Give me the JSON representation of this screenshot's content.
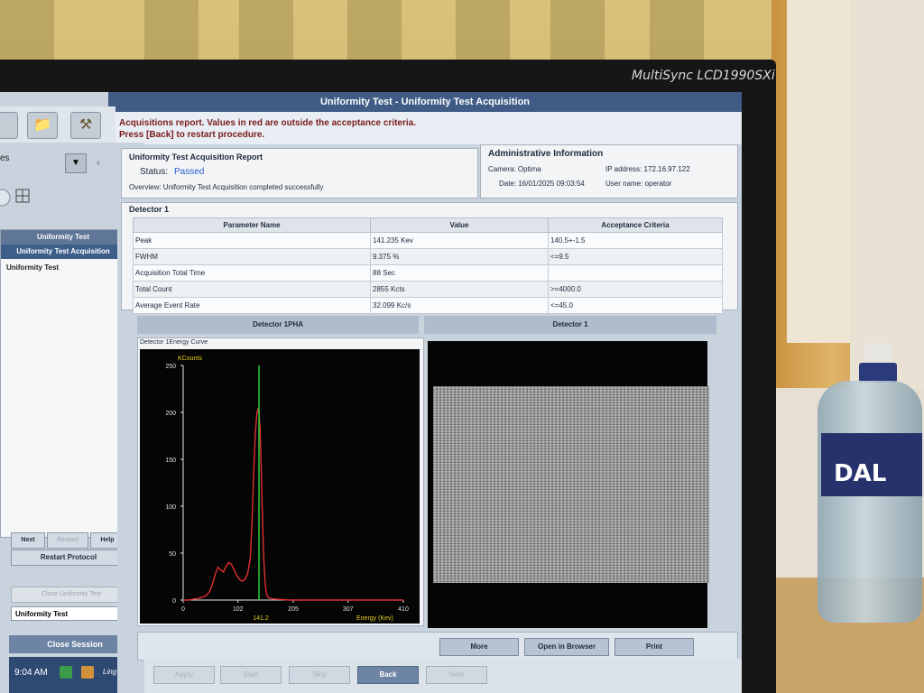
{
  "monitor": {
    "brand": "MultiSync LCD1990SXi"
  },
  "bottle": {
    "label": "DAL"
  },
  "window": {
    "title": "Uniformity Test  - Uniformity Test Acquisition"
  },
  "message": {
    "line1": "Acquisitions report. Values in red are outside the acceptance criteria.",
    "line2": "Press [Back] to restart procedure."
  },
  "sidebar": {
    "dropdown_text": "es",
    "header": "Uniformity Test",
    "selected_item": "Uniformity Test Acquisition",
    "item": "Uniformity Test",
    "buttons": {
      "next": "Next",
      "middle": "Restart",
      "help": "Help"
    },
    "restart_protocol": "Restart Protocol",
    "close_test": "Close Uniformity Test",
    "select_value": "Uniformity Test",
    "close_session": "Close Session"
  },
  "taskbar": {
    "time": "9:04 AM",
    "ling": "Ling"
  },
  "report": {
    "title": "Uniformity Test Acquisition Report",
    "status_label": "Status:",
    "status_value": "Passed",
    "overview": "Overview: Uniformity Test Acquisition completed successfully"
  },
  "admin": {
    "title": "Administrative Information",
    "camera": "Camera: Optima",
    "ip": "IP address: 172.16.97.122",
    "date": "Date: 16/01/2025 09:03:54",
    "user": "User name: operator"
  },
  "detector": {
    "title": "Detector 1",
    "columns": [
      "Parameter Name",
      "Value",
      "Acceptance Criteria"
    ],
    "rows": [
      [
        "Peak",
        "141.235 Kev",
        "140.5+-1.5"
      ],
      [
        "FWHM",
        "9.375 %",
        "<=9.5"
      ],
      [
        "Acquisition Total Time",
        "88 Sec",
        ""
      ],
      [
        "Total Count",
        "2855 Kcts",
        ">=4000.0"
      ],
      [
        "Average Event Rate",
        "32.099 Kc/s",
        "<=45.0"
      ]
    ]
  },
  "pha": {
    "header": "Detector 1PHA",
    "subtitle": "Detector 1Energy Curve"
  },
  "image_panel": {
    "header": "Detector 1"
  },
  "chart_data": {
    "type": "line",
    "title": "Detector 1Energy Curve",
    "ylabel": "KCounts",
    "xlabel": "Energy (Kev)",
    "xlim": [
      0,
      410
    ],
    "ylim": [
      0,
      250
    ],
    "x_ticks": [
      0,
      102,
      205,
      307,
      410
    ],
    "y_ticks": [
      0,
      50,
      100,
      150,
      200,
      250
    ],
    "marker_label": "141.2",
    "marker_color": "#33cc33",
    "series": [
      {
        "color": "#e03030",
        "x": [
          0,
          10,
          20,
          30,
          40,
          45,
          50,
          55,
          60,
          65,
          70,
          75,
          80,
          85,
          90,
          95,
          100,
          105,
          110,
          115,
          120,
          125,
          128,
          131,
          134,
          137,
          139,
          141,
          143,
          145,
          147,
          150,
          153,
          156,
          160,
          170,
          200,
          250,
          300,
          350,
          410
        ],
        "y": [
          0,
          0,
          1,
          2,
          4,
          6,
          10,
          18,
          28,
          35,
          32,
          30,
          36,
          40,
          38,
          32,
          26,
          22,
          20,
          22,
          28,
          45,
          80,
          130,
          175,
          198,
          203,
          200,
          185,
          150,
          100,
          45,
          15,
          5,
          2,
          1,
          0,
          0,
          0,
          0,
          0
        ]
      }
    ],
    "line_annotation": "141.2"
  },
  "bottom_buttons": {
    "more": "More",
    "open_browser": "Open in Browser",
    "print": "Print"
  },
  "nav": {
    "apply": "Apply",
    "start": "Start",
    "skip": "Skip",
    "back": "Back",
    "next": "Next"
  }
}
